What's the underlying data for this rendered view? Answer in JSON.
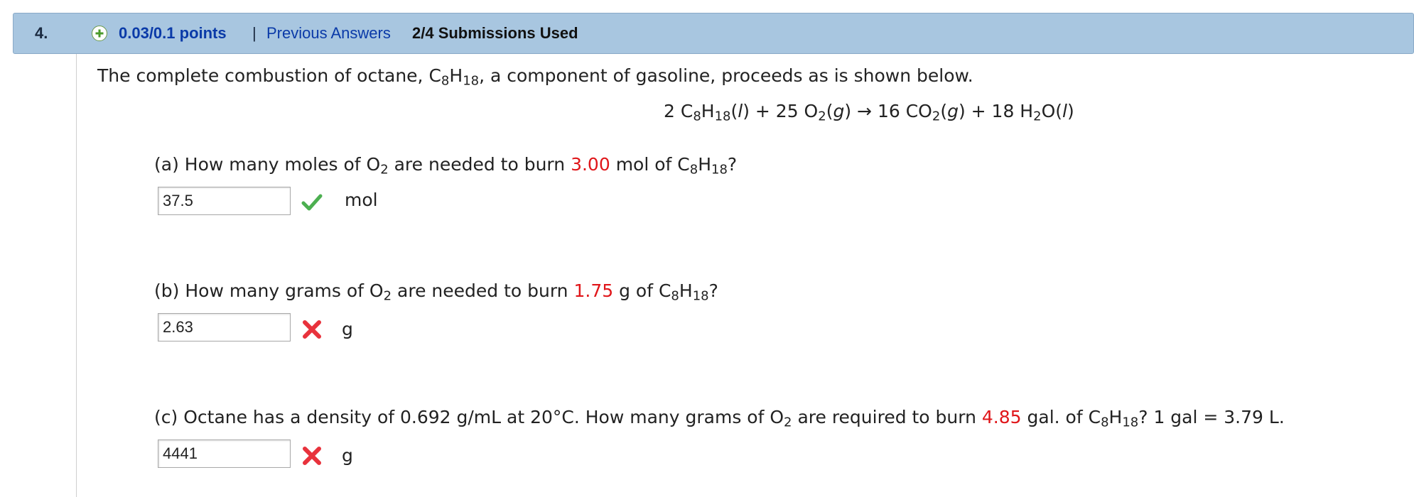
{
  "header": {
    "question_number": "4.",
    "points": "0.03/0.1 points",
    "separator": "|",
    "previous_answers_link": "Previous Answers",
    "submissions": "2/4 Submissions Used"
  },
  "intro": {
    "text_before": "The complete combustion of octane, C",
    "sub_8": "8",
    "h": "H",
    "sub_18": "18",
    "text_after": ", a component of gasoline, proceeds as is shown below."
  },
  "equation": {
    "part1": "2 C",
    "s8": "8",
    "h": "H",
    "s18": "18",
    "phase_l": "l",
    "part2": "+ 25 O",
    "s2": "2",
    "phase_g": "g",
    "arrow": "→",
    "part3": "16 CO",
    "s2b": "2",
    "phase_g2": "g",
    "part4": "+ 18 H",
    "s2c": "2",
    "part5": "O",
    "phase_l2": "l"
  },
  "colors": {
    "header_bg": "#a8c6e0",
    "link": "#0a3aa8",
    "highlight_red": "#e0161a",
    "correct_green": "#4caf50",
    "incorrect_red": "#e8323c"
  },
  "parts": [
    {
      "label": "(a)",
      "q_pre": "How many moles of O",
      "q_sub": "2",
      "q_mid": "are needed to burn",
      "value": "3.00",
      "q_post": "mol of C",
      "s8": "8",
      "h": "H",
      "s18": "18",
      "end": "?",
      "answer": "37.5",
      "status_icon": "checkmark-icon",
      "unit": "mol"
    },
    {
      "label": "(b)",
      "q_pre": "How many grams of O",
      "q_sub": "2",
      "q_mid": "are needed to burn",
      "value": "1.75",
      "q_post": "g of C",
      "s8": "8",
      "h": "H",
      "s18": "18",
      "end": "?",
      "answer": "2.63",
      "status_icon": "x-icon",
      "unit": "g"
    },
    {
      "label": "(c)",
      "q_pre": "Octane has a density of 0.692 g/mL at 20°C. How many grams of O",
      "q_sub": "2",
      "q_mid": "are required to burn",
      "value": "4.85",
      "q_post": "gal. of C",
      "s8": "8",
      "h": "H",
      "s18": "18",
      "end": "? 1 gal = 3.79 L.",
      "answer": "4441",
      "status_icon": "x-icon",
      "unit": "g"
    }
  ]
}
